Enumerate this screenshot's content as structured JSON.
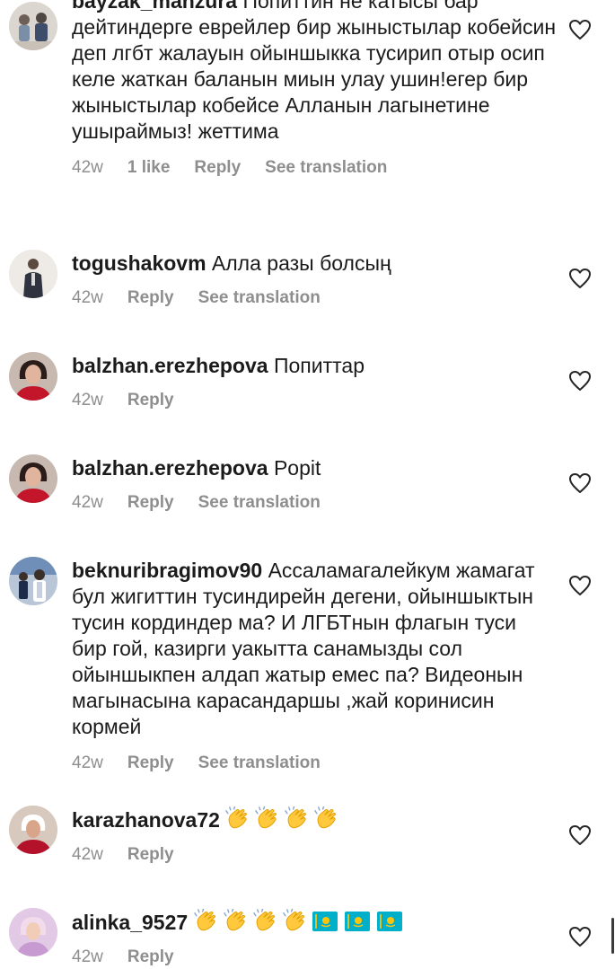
{
  "colors": {
    "text": "#1b1b1b",
    "meta": "#8e8e8e",
    "heart_stroke": "#262626",
    "flag_blue": "#00afca",
    "flag_gold": "#fec50c",
    "clap_yellow": "#ffc83d"
  },
  "icons": {
    "like": "heart-outline-icon",
    "clap": "clapping-hands-emoji",
    "flag": "kazakhstan-flag-emoji"
  },
  "comments": [
    {
      "username": "bayzak_manzura",
      "text": "Попиттин не катысы бар дейтиндерге еврейлер бир жыныстылар кобейсин деп лгбт жалауын ойыншыкка тусирип отыр осип келе жаткан баланын миын улау ушин!егер бир жыныстылар кобейсе Алланын лагынетине ушыраймыз! жеттима",
      "age": "42w",
      "likes": "1 like",
      "reply": "Reply",
      "translate": "See translation"
    },
    {
      "username": "togushakovm",
      "text": "Алла разы болсың",
      "age": "42w",
      "reply": "Reply",
      "translate": "See translation"
    },
    {
      "username": "balzhan.erezhepova",
      "text": "Попиттар",
      "age": "42w",
      "reply": "Reply"
    },
    {
      "username": "balzhan.erezhepova",
      "text": "Popit",
      "age": "42w",
      "reply": "Reply",
      "translate": "See translation"
    },
    {
      "username": "beknuribragimov90",
      "text": "Ассаламагалейкум жамагат  бул жигиттин тусиндирейн дегени, ойыншыктын тусин кординдер ма? И ЛГБТнын флагын туси бир гой, казирги уакытта санамызды сол ойыншыкпен алдап жатыр емес па? Видеонын магынасына карасандаршы ,жай коринисин кормей",
      "age": "42w",
      "reply": "Reply",
      "translate": "See translation"
    },
    {
      "username": "karazhanova72",
      "text": "",
      "age": "42w",
      "reply": "Reply"
    },
    {
      "username": "alinka_9527",
      "text": "",
      "age": "42w",
      "reply": "Reply"
    }
  ]
}
